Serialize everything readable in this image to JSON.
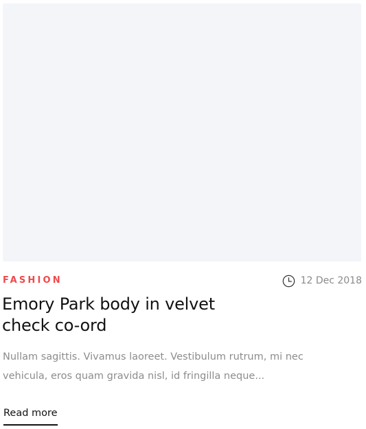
{
  "post": {
    "category": "FASHION",
    "date": "12 Dec 2018",
    "title": "Emory Park body in velvet check co-ord",
    "excerpt": "Nullam sagittis. Vivamus laoreet. Vestibulum rutrum, mi nec vehicula, eros quam gravida nisl, id fringilla neque...",
    "read_more_label": "Read more"
  },
  "icons": {
    "date": "clock-icon"
  },
  "colors": {
    "category": "#f2484c",
    "thumbnail_placeholder": "#f3f5f9",
    "title": "#111111",
    "muted_text": "#8a8a8a"
  }
}
